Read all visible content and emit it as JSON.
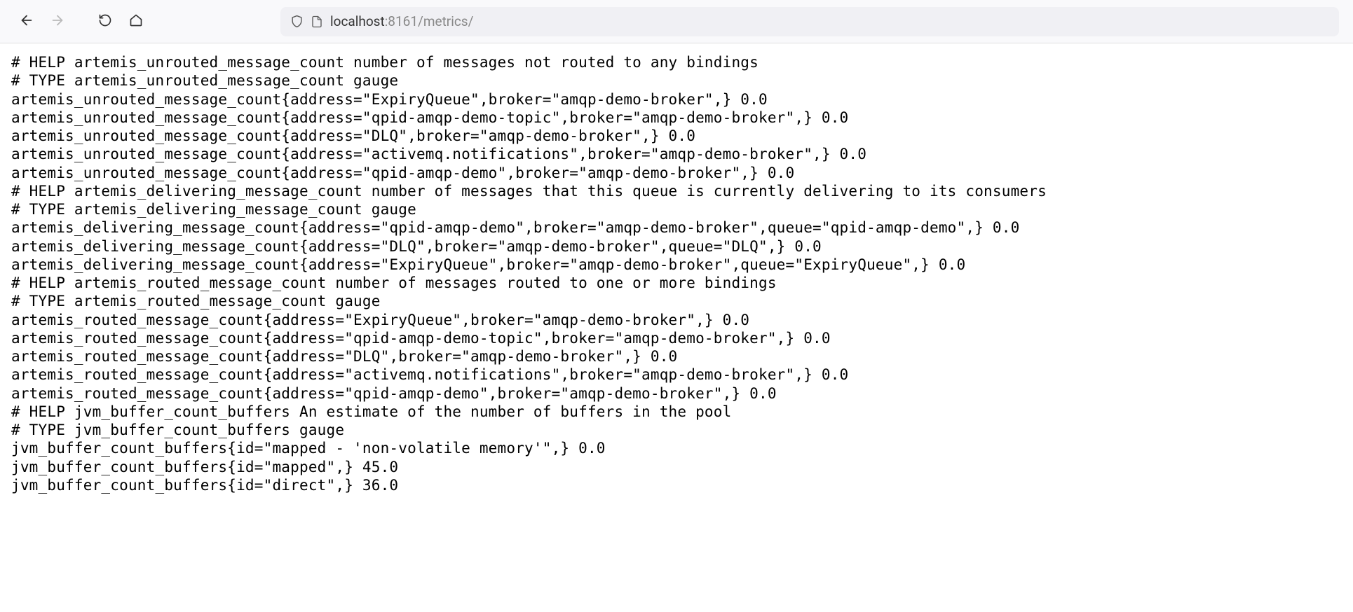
{
  "address": {
    "host": "localhost",
    "port": ":8161",
    "path": "/metrics/"
  },
  "metrics": {
    "groups": [
      {
        "name": "artemis_unrouted_message_count",
        "help": "number of messages not routed to any bindings",
        "type": "gauge",
        "samples": [
          {
            "labels": "address=\"ExpiryQueue\",broker=\"amqp-demo-broker\",",
            "value": "0.0"
          },
          {
            "labels": "address=\"qpid-amqp-demo-topic\",broker=\"amqp-demo-broker\",",
            "value": "0.0"
          },
          {
            "labels": "address=\"DLQ\",broker=\"amqp-demo-broker\",",
            "value": "0.0"
          },
          {
            "labels": "address=\"activemq.notifications\",broker=\"amqp-demo-broker\",",
            "value": "0.0"
          },
          {
            "labels": "address=\"qpid-amqp-demo\",broker=\"amqp-demo-broker\",",
            "value": "0.0"
          }
        ]
      },
      {
        "name": "artemis_delivering_message_count",
        "help": "number of messages that this queue is currently delivering to its consumers",
        "type": "gauge",
        "samples": [
          {
            "labels": "address=\"qpid-amqp-demo\",broker=\"amqp-demo-broker\",queue=\"qpid-amqp-demo\",",
            "value": "0.0"
          },
          {
            "labels": "address=\"DLQ\",broker=\"amqp-demo-broker\",queue=\"DLQ\",",
            "value": "0.0"
          },
          {
            "labels": "address=\"ExpiryQueue\",broker=\"amqp-demo-broker\",queue=\"ExpiryQueue\",",
            "value": "0.0"
          }
        ]
      },
      {
        "name": "artemis_routed_message_count",
        "help": "number of messages routed to one or more bindings",
        "type": "gauge",
        "samples": [
          {
            "labels": "address=\"ExpiryQueue\",broker=\"amqp-demo-broker\",",
            "value": "0.0"
          },
          {
            "labels": "address=\"qpid-amqp-demo-topic\",broker=\"amqp-demo-broker\",",
            "value": "0.0"
          },
          {
            "labels": "address=\"DLQ\",broker=\"amqp-demo-broker\",",
            "value": "0.0"
          },
          {
            "labels": "address=\"activemq.notifications\",broker=\"amqp-demo-broker\",",
            "value": "0.0"
          },
          {
            "labels": "address=\"qpid-amqp-demo\",broker=\"amqp-demo-broker\",",
            "value": "0.0"
          }
        ]
      },
      {
        "name": "jvm_buffer_count_buffers",
        "help": "An estimate of the number of buffers in the pool",
        "type": "gauge",
        "samples": [
          {
            "labels": "id=\"mapped - 'non-volatile memory'\",",
            "value": "0.0"
          },
          {
            "labels": "id=\"mapped\",",
            "value": "45.0"
          },
          {
            "labels": "id=\"direct\",",
            "value": "36.0"
          }
        ]
      }
    ]
  }
}
